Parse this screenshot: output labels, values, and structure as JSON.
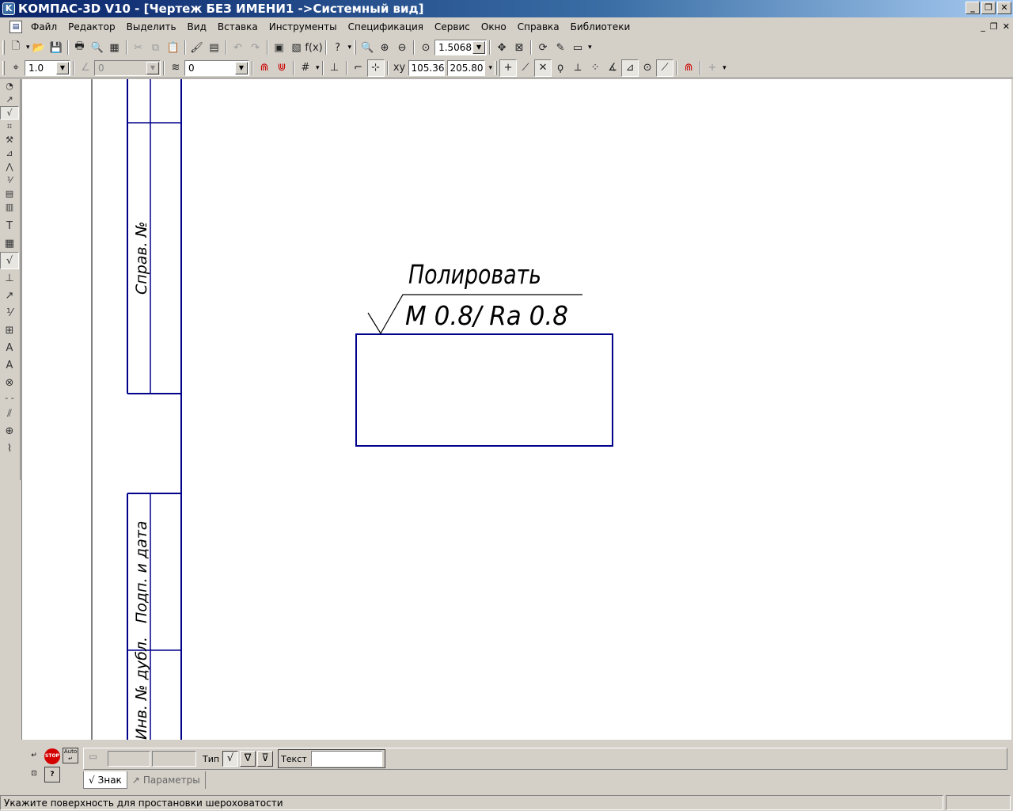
{
  "window": {
    "title": "КОМПАС-3D V10 - [Чертеж БЕЗ ИМЕНИ1 ->Системный вид]",
    "app_icon": "K",
    "controls": [
      "_",
      "❐",
      "✕"
    ]
  },
  "menu": {
    "items": [
      "Файл",
      "Редактор",
      "Выделить",
      "Вид",
      "Вставка",
      "Инструменты",
      "Спецификация",
      "Сервис",
      "Окно",
      "Справка",
      "Библиотеки"
    ],
    "mdi_controls": [
      "_",
      "❐",
      "✕"
    ]
  },
  "toolbar1": {
    "zoom_value": "1.5068"
  },
  "toolbar2": {
    "step_value": "1.0",
    "angle_value": "0",
    "layer_value": "0",
    "coord_x": "105.36",
    "coord_y": "205.80"
  },
  "drawing": {
    "stamp_labels": [
      "Справ. №",
      "Подп. и дата",
      "Инв. № дубл."
    ],
    "roughness_note": "Полировать",
    "roughness_value": "M 0.8/ Ra 0.8"
  },
  "properties": {
    "type_label": "Тип",
    "text_label": "Текст",
    "tabs": [
      {
        "label": "Знак",
        "active": true
      },
      {
        "label": "Параметры",
        "active": false
      }
    ]
  },
  "status": {
    "text": "Укажите поверхность для простановки шероховатости"
  },
  "colors": {
    "title_gradient_start": "#0a246a",
    "drawing_line": "#00008b"
  }
}
